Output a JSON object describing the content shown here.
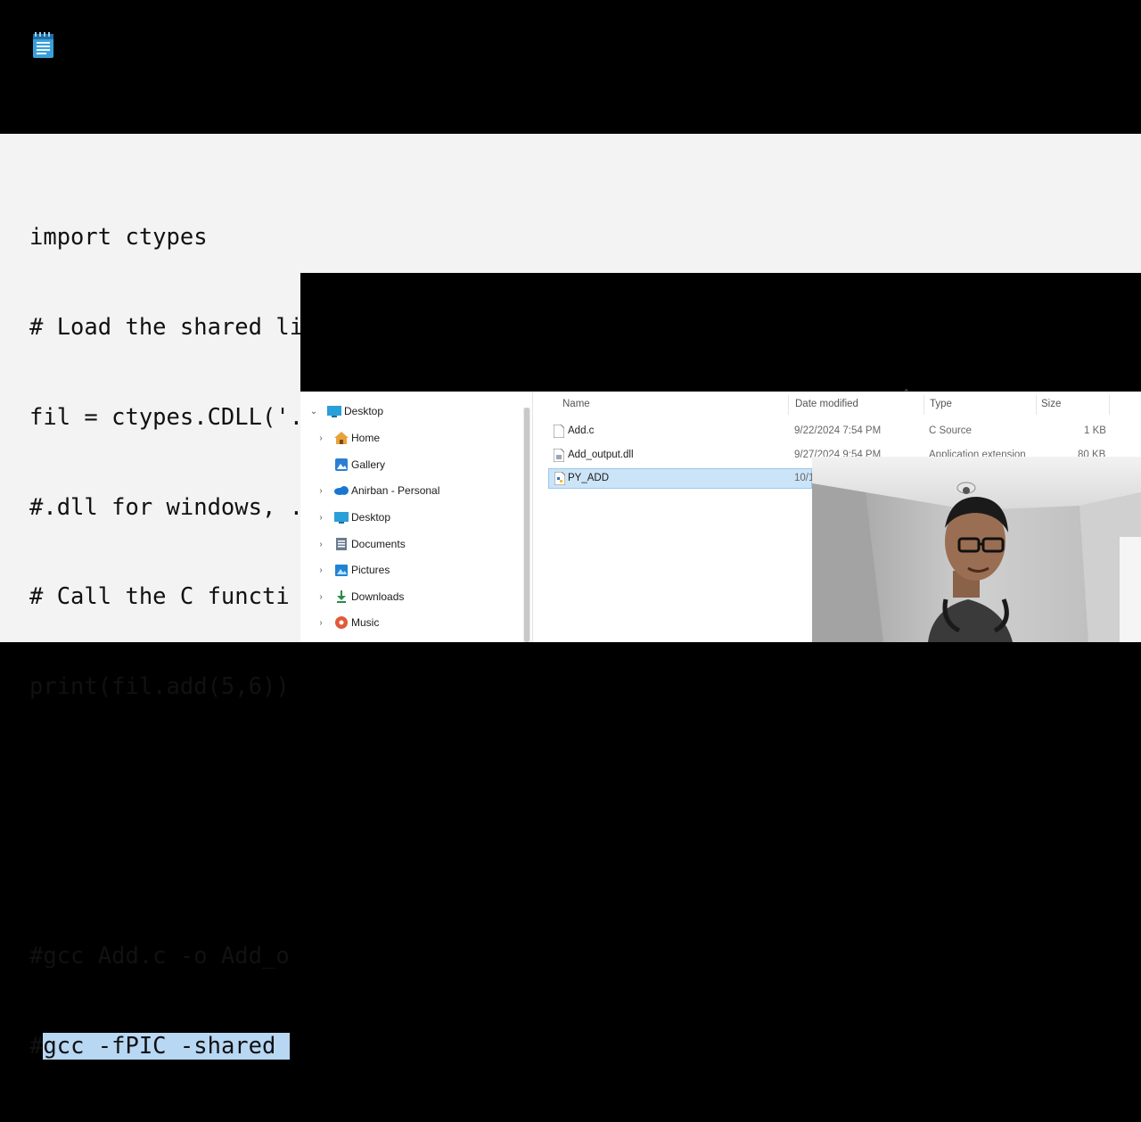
{
  "app": {
    "icon": "notepad-icon"
  },
  "editor": {
    "lines": [
      "import ctypes",
      "# Load the shared library into c types.",
      "fil = ctypes.CDLL('./Add_output.dll')",
      "#.dll for windows, .so for linux",
      "# Call the C functi",
      "print(fil.add(5,6))",
      "",
      "",
      "#gcc Add.c -o Add_o",
      "#gcc -fPIC -shared "
    ],
    "selection_prefix": "#",
    "selection_text": "gcc -fPIC -shared "
  },
  "explorer": {
    "nav_items": [
      {
        "label": "Desktop",
        "icon": "desktop-icon",
        "expanded": true
      },
      {
        "label": "Home",
        "icon": "home-icon"
      },
      {
        "label": "Gallery",
        "icon": "gallery-icon"
      },
      {
        "label": "Anirban - Personal",
        "icon": "onedrive-icon"
      },
      {
        "label": "Desktop",
        "icon": "desktop-icon"
      },
      {
        "label": "Documents",
        "icon": "documents-icon"
      },
      {
        "label": "Pictures",
        "icon": "pictures-icon"
      },
      {
        "label": "Downloads",
        "icon": "downloads-icon"
      },
      {
        "label": "Music",
        "icon": "music-icon"
      }
    ],
    "columns": {
      "name": "Name",
      "date": "Date modified",
      "type": "Type",
      "size": "Size"
    },
    "files": [
      {
        "name": "Add.c",
        "date": "9/22/2024 7:54 PM",
        "type": "C Source",
        "size": "1 KB",
        "icon": "c-file-icon"
      },
      {
        "name": "Add_output.dll",
        "date": "9/27/2024 9:54 PM",
        "type": "Application extension",
        "size": "80 KB",
        "icon": "dll-file-icon"
      },
      {
        "name": "PY_ADD",
        "date": "10/1",
        "type": "",
        "size": "",
        "icon": "python-file-icon",
        "selected": true
      }
    ]
  },
  "colors": {
    "selection": "#b7d7f3",
    "editor_bg": "#f3f3f3",
    "explorer_selected": "#cce4f7"
  }
}
